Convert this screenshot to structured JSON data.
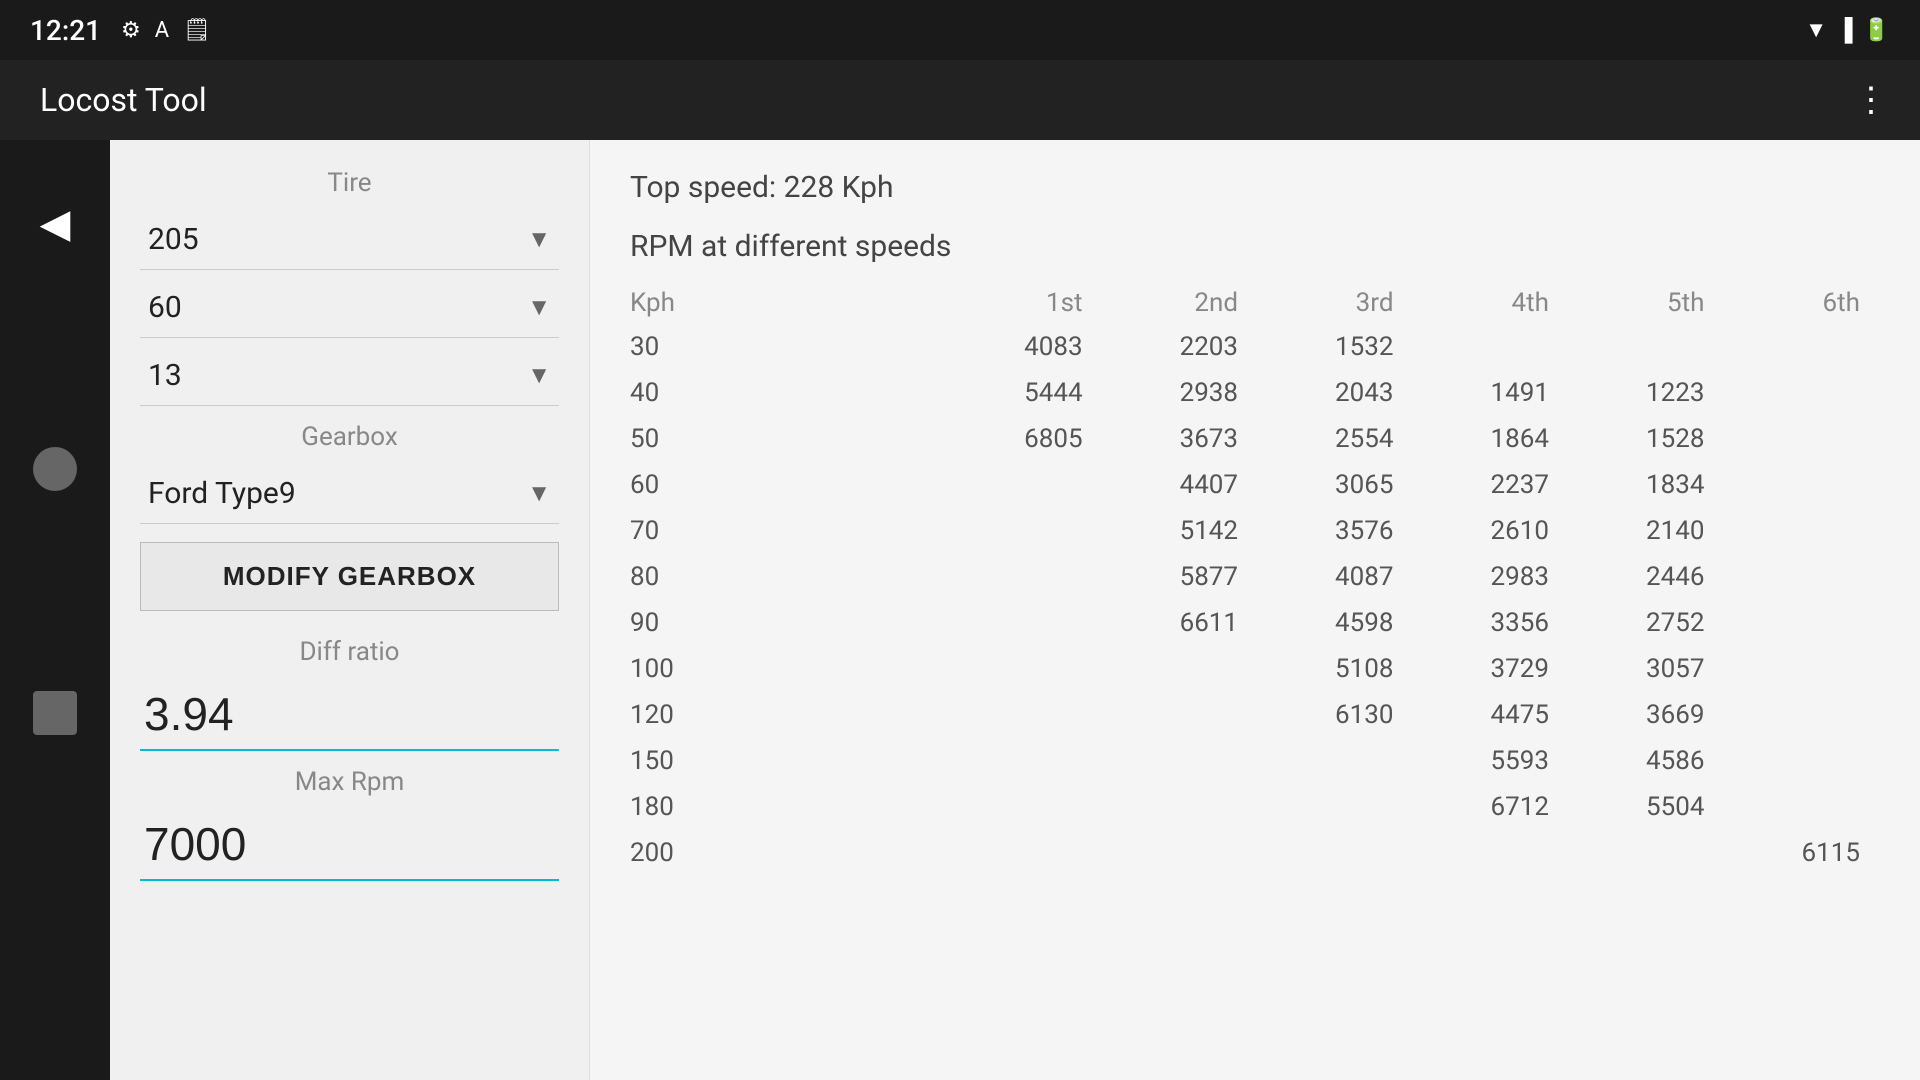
{
  "statusBar": {
    "time": "12:21",
    "icons": [
      "⚙",
      "A",
      "🗒"
    ]
  },
  "appBar": {
    "title": "Locost Tool",
    "menuIcon": "⋮"
  },
  "leftPanel": {
    "tireSectionLabel": "Tire",
    "tireWidth": "205",
    "tireProfile": "60",
    "tireRim": "13",
    "gearboxSectionLabel": "Gearbox",
    "gearboxSelected": "Ford Type9",
    "modifyGearboxLabel": "MODIFY GEARBOX",
    "diffRatioLabel": "Diff ratio",
    "diffRatioValue": "3.94",
    "maxRpmLabel": "Max Rpm",
    "maxRpmValue": "7000"
  },
  "rightPanel": {
    "topSpeedLabel": "Top speed: 228 Kph",
    "rpmSectionTitle": "RPM at different speeds",
    "headers": [
      "Kph",
      "1st",
      "2nd",
      "3rd",
      "4th",
      "5th",
      "6th"
    ],
    "rows": [
      {
        "kph": "30",
        "1st": "4083",
        "2nd": "2203",
        "3rd": "1532",
        "4th": "",
        "5th": "",
        "6th": ""
      },
      {
        "kph": "40",
        "1st": "5444",
        "2nd": "2938",
        "3rd": "2043",
        "4th": "1491",
        "5th": "1223",
        "6th": ""
      },
      {
        "kph": "50",
        "1st": "6805",
        "2nd": "3673",
        "3rd": "2554",
        "4th": "1864",
        "5th": "1528",
        "6th": ""
      },
      {
        "kph": "60",
        "1st": "",
        "2nd": "4407",
        "3rd": "3065",
        "4th": "2237",
        "5th": "1834",
        "6th": ""
      },
      {
        "kph": "70",
        "1st": "",
        "2nd": "5142",
        "3rd": "3576",
        "4th": "2610",
        "5th": "2140",
        "6th": ""
      },
      {
        "kph": "80",
        "1st": "",
        "2nd": "5877",
        "3rd": "4087",
        "4th": "2983",
        "5th": "2446",
        "6th": ""
      },
      {
        "kph": "90",
        "1st": "",
        "2nd": "6611",
        "3rd": "4598",
        "4th": "3356",
        "5th": "2752",
        "6th": ""
      },
      {
        "kph": "100",
        "1st": "",
        "2nd": "",
        "3rd": "5108",
        "4th": "3729",
        "5th": "3057",
        "6th": ""
      },
      {
        "kph": "120",
        "1st": "",
        "2nd": "",
        "3rd": "6130",
        "4th": "4475",
        "5th": "3669",
        "6th": ""
      },
      {
        "kph": "150",
        "1st": "",
        "2nd": "",
        "3rd": "",
        "4th": "5593",
        "5th": "4586",
        "6th": ""
      },
      {
        "kph": "180",
        "1st": "",
        "2nd": "",
        "3rd": "",
        "4th": "6712",
        "5th": "5504",
        "6th": ""
      },
      {
        "kph": "200",
        "1st": "",
        "2nd": "",
        "3rd": "",
        "4th": "",
        "5th": "",
        "6th": "6115"
      }
    ]
  }
}
